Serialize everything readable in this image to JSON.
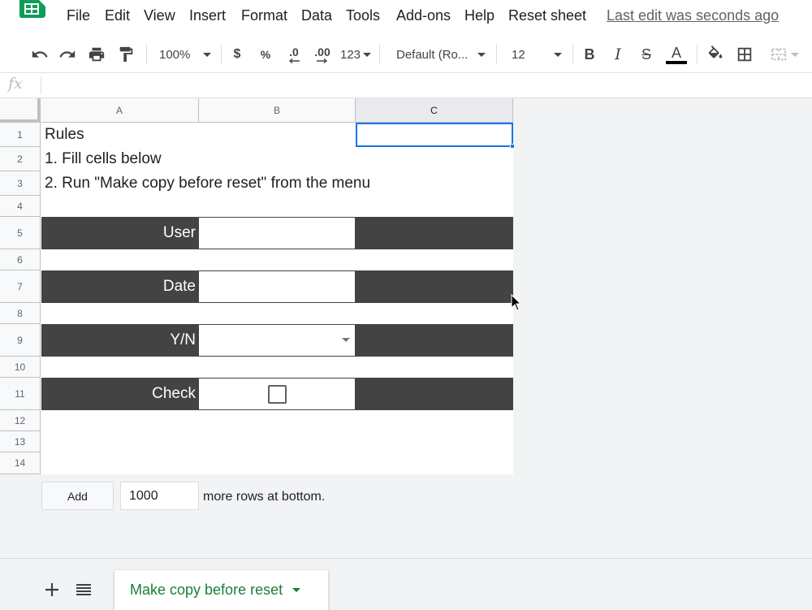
{
  "menubar": {
    "items": [
      "File",
      "Edit",
      "View",
      "Insert",
      "Format",
      "Data",
      "Tools",
      "Add-ons",
      "Help",
      "Reset sheet"
    ],
    "last_edit": "Last edit was seconds ago"
  },
  "toolbar": {
    "zoom": "100%",
    "currency": "$",
    "percent": "%",
    "decrease_decimals": ".0",
    "increase_decimals": ".00",
    "more_formats": "123",
    "font": "Default (Ro...",
    "font_size": "12",
    "bold": "B",
    "italic": "I",
    "strikethrough": "S",
    "text_color_letter": "A"
  },
  "grid": {
    "columns": [
      "A",
      "B",
      "C"
    ],
    "rows": [
      "1",
      "2",
      "3",
      "4",
      "5",
      "6",
      "7",
      "8",
      "9",
      "10",
      "11",
      "12",
      "13",
      "14"
    ],
    "cells": {
      "a1": "Rules",
      "a2": "1. Fill cells below",
      "a3": "2. Run \"Make copy before reset\" from the menu",
      "a5": "User",
      "a7": "Date",
      "a9": "Y/N",
      "a11": "Check"
    },
    "band_color": "#434343",
    "selection_color": "#1a73e8"
  },
  "add_rows": {
    "button": "Add",
    "count": "1000",
    "label": "more rows at bottom."
  },
  "sheets": {
    "active": "Make copy before reset",
    "active_color": "#188038"
  }
}
